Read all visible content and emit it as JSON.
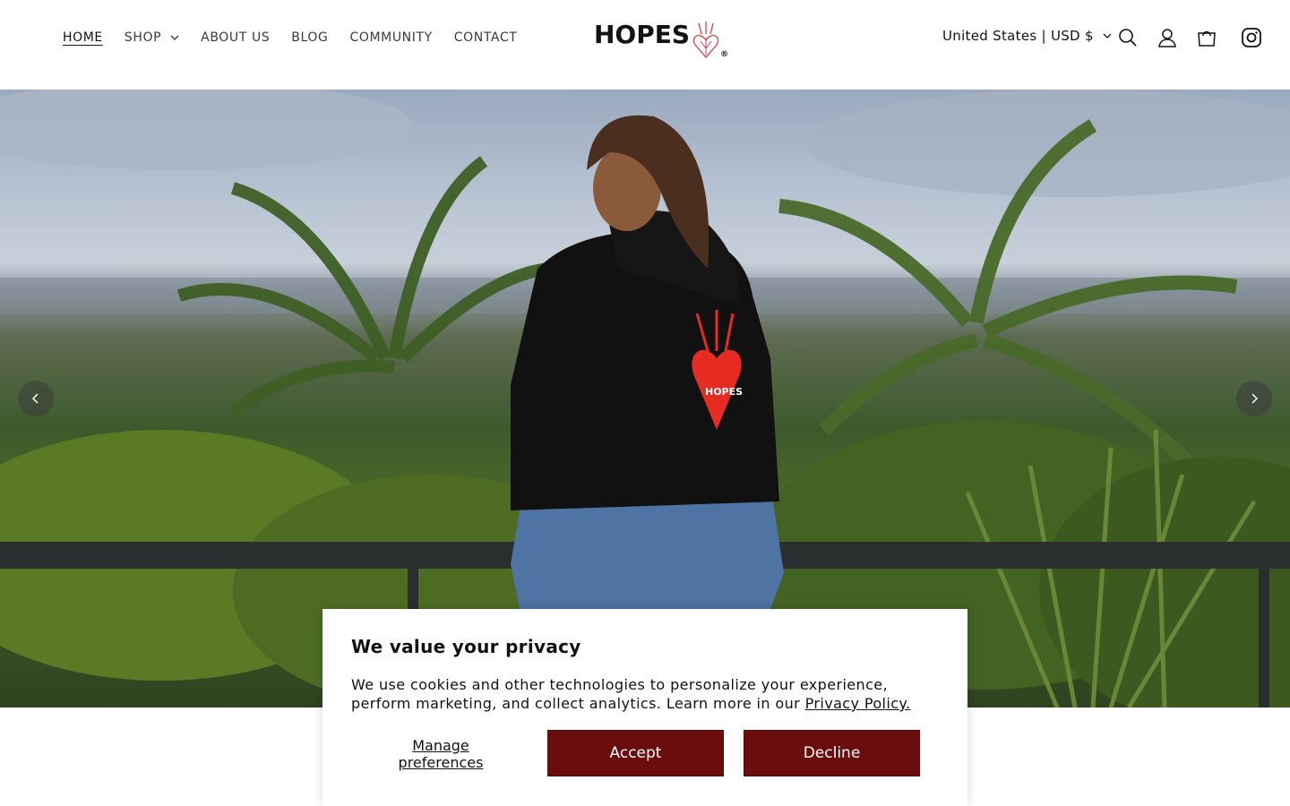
{
  "header": {
    "nav": [
      {
        "label": "HOME"
      },
      {
        "label": "SHOP"
      },
      {
        "label": "ABOUT US"
      },
      {
        "label": "BLOG"
      },
      {
        "label": "COMMUNITY"
      },
      {
        "label": "CONTACT"
      }
    ],
    "logo": {
      "text": "HOPES",
      "reg": "®"
    },
    "region": "United States | USD $",
    "icons": [
      "search-icon",
      "account-icon",
      "cart-icon",
      "instagram-icon"
    ]
  },
  "hero": {
    "hoodie_print": "HOPES",
    "arrows": [
      "chevron-left-icon",
      "chevron-right-icon"
    ]
  },
  "cookie": {
    "title": "We value your privacy",
    "text": "We use cookies and other technologies to personalize your experience, perform marketing, and collect analytics. Learn more in our ",
    "link": "Privacy Policy.",
    "manage": "Manage preferences",
    "accept": "Accept",
    "decline": "Decline"
  },
  "colors": {
    "accent": "#6b0d0d",
    "heart": "#e52b22"
  }
}
